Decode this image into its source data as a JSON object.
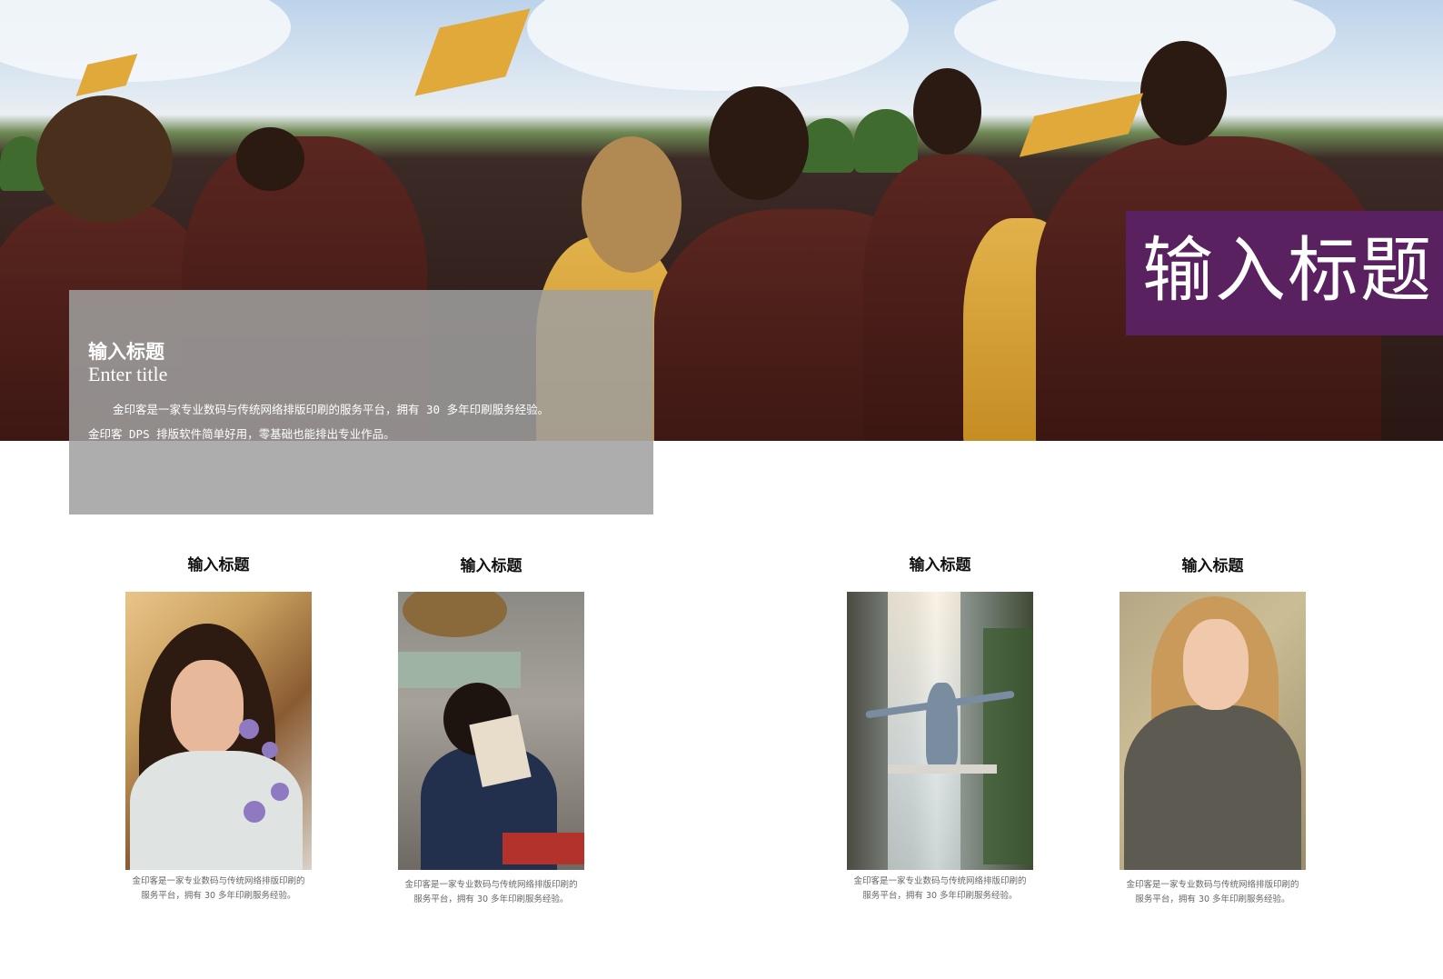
{
  "hero": {
    "title": "输入标题",
    "colors": {
      "title_block": "#5a2161",
      "info_box": "#a0a0a0"
    }
  },
  "info": {
    "title": "输入标题",
    "subtitle": "Enter title",
    "line1": "金印客是一家专业数码与传统网络排版印刷的服务平台，拥有 30 多年印刷服务经验。",
    "line2": "金印客 DPS 排版软件简单好用，零基础也能排出专业作品。"
  },
  "cards": [
    {
      "title": "输入标题",
      "cap1": "金印客是一家专业数码与传统网络排版印刷的",
      "cap2": "服务平台，拥有 30 多年印刷服务经验。"
    },
    {
      "title": "输入标题",
      "cap1": "金印客是一家专业数码与传统网络排版印刷的",
      "cap2": "服务平台，拥有 30 多年印刷服务经验。"
    },
    {
      "title": "输入标题",
      "cap1": "金印客是一家专业数码与传统网络排版印刷的",
      "cap2": "服务平台，拥有 30 多年印刷服务经验。"
    },
    {
      "title": "输入标题",
      "cap1": "金印客是一家专业数码与传统网络排版印刷的",
      "cap2": "服务平台，拥有 30 多年印刷服务经验。"
    }
  ]
}
